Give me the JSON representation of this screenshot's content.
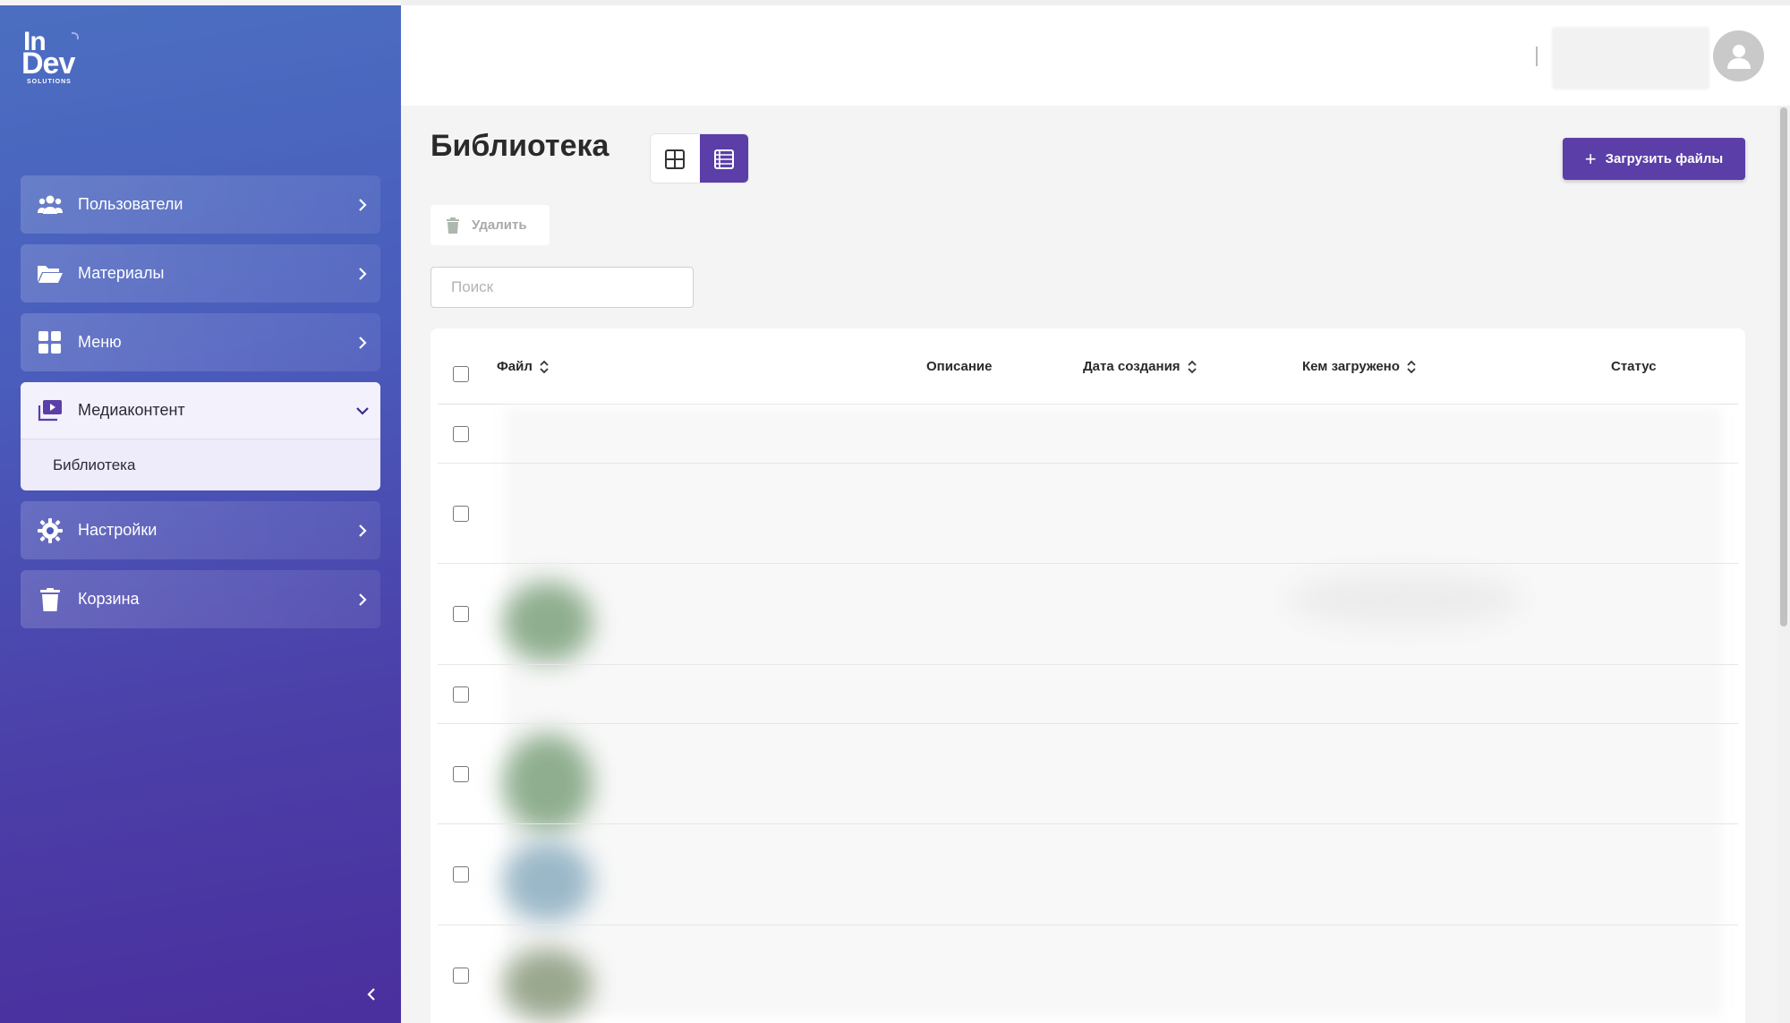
{
  "brand": {
    "line1": "In",
    "line2": "Dev",
    "line3": "SOLUTIONS"
  },
  "sidebar": {
    "items": [
      {
        "label": "Пользователи",
        "icon": "users-icon"
      },
      {
        "label": "Материалы",
        "icon": "folder-open-icon"
      },
      {
        "label": "Меню",
        "icon": "grid-icon"
      },
      {
        "label": "Медиаконтент",
        "icon": "media-icon",
        "expanded": true,
        "children": [
          {
            "label": "Библиотека"
          }
        ]
      },
      {
        "label": "Настройки",
        "icon": "gear-icon"
      },
      {
        "label": "Корзина",
        "icon": "trash-icon"
      }
    ]
  },
  "page": {
    "title": "Библиотека",
    "view_mode": "list",
    "upload_label": "Загрузить файлы",
    "delete_label": "Удалить",
    "search_placeholder": "Поиск",
    "search_value": ""
  },
  "table": {
    "columns": [
      {
        "label": "Файл",
        "sortable": true
      },
      {
        "label": "Описание",
        "sortable": false
      },
      {
        "label": "Дата создания",
        "sortable": true
      },
      {
        "label": "Кем загружено",
        "sortable": true
      },
      {
        "label": "Статус",
        "sortable": false
      }
    ],
    "row_count_visible": 7
  },
  "colors": {
    "accent": "#5b3ea8",
    "sidebar_gradient_start": "#4b6fc1",
    "sidebar_gradient_end": "#4a2f9d",
    "background": "#f4f4f4"
  }
}
